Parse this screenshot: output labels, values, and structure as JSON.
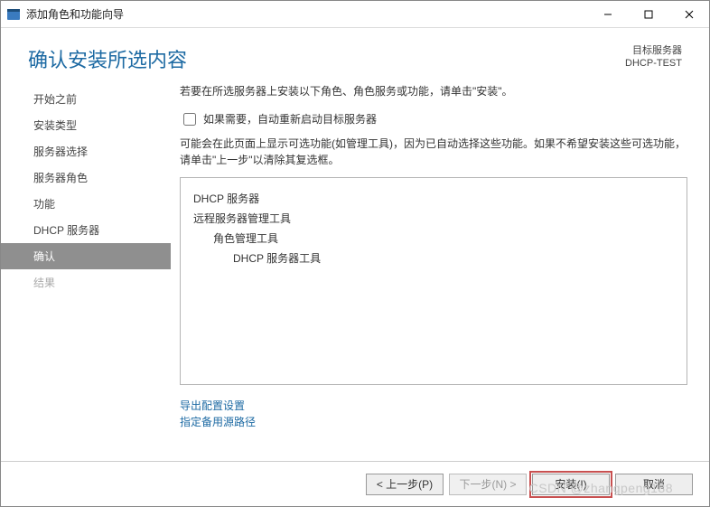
{
  "titlebar": {
    "title": "添加角色和功能向导"
  },
  "header": {
    "page_title": "确认安装所选内容",
    "target_label": "目标服务器",
    "target_value": "DHCP-TEST"
  },
  "sidebar": {
    "items": [
      {
        "label": "开始之前"
      },
      {
        "label": "安装类型"
      },
      {
        "label": "服务器选择"
      },
      {
        "label": "服务器角色"
      },
      {
        "label": "功能"
      },
      {
        "label": "DHCP 服务器"
      },
      {
        "label": "确认"
      },
      {
        "label": "结果"
      }
    ]
  },
  "main": {
    "intro": "若要在所选服务器上安装以下角色、角色服务或功能，请单击\"安装\"。",
    "checkbox_label": "如果需要，自动重新启动目标服务器",
    "note": "可能会在此页面上显示可选功能(如管理工具)，因为已自动选择这些功能。如果不希望安装这些可选功能，请单击\"上一步\"以清除其复选框。",
    "list": {
      "l1a": "DHCP 服务器",
      "l1b": "远程服务器管理工具",
      "l2": "角色管理工具",
      "l3": "DHCP 服务器工具"
    },
    "link1": "导出配置设置",
    "link2": "指定备用源路径"
  },
  "footer": {
    "prev": "< 上一步(P)",
    "next": "下一步(N) >",
    "install": "安装(I)",
    "cancel": "取消"
  },
  "watermark": "CSDN @zhangpeng188"
}
